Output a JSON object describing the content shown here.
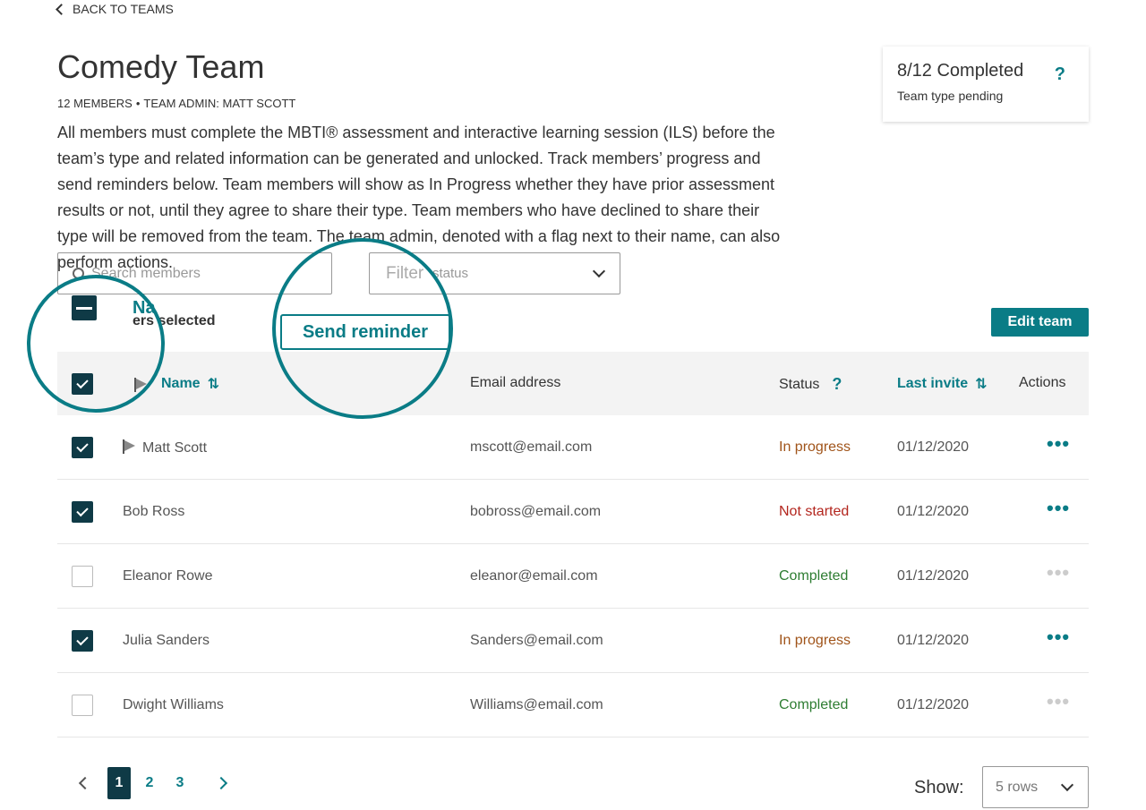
{
  "nav": {
    "back_label": "BACK TO TEAMS"
  },
  "team": {
    "title": "Comedy Team",
    "members_meta": "12 MEMBERS",
    "separator": "•",
    "admin_meta": "TEAM ADMIN: MATT SCOTT",
    "description": "All members must complete the MBTI® assessment and interactive learning session (ILS) before the team’s type and related information can be generated and unlocked. Track members’ progress and send reminders below. Team members will show as In Progress whether they have prior assessment results or not, until they agree to share their type. Team members who have declined to share their type will be removed from the team. The team admin, denoted with a flag next to their name, can also perform actions."
  },
  "status_card": {
    "completed": "8/12 Completed",
    "help_icon": "?",
    "pending": "Team type pending"
  },
  "search": {
    "placeholder": "Search members"
  },
  "filter": {
    "label_big": "Filter",
    "label_small": "status"
  },
  "bulk": {
    "selected_text": "ers selected",
    "send_reminder": "Send reminder",
    "edit_team": "Edit team"
  },
  "table": {
    "headers": {
      "name": "Name",
      "email": "Email address",
      "status": "Status",
      "status_help": "?",
      "last_invite": "Last invite",
      "actions": "Actions"
    },
    "rows": [
      {
        "name": "Matt Scott",
        "email": "mscott@email.com",
        "status": "In progress",
        "date": "01/12/2020",
        "checked": true,
        "admin": true
      },
      {
        "name": "Bob Ross",
        "email": "bobross@email.com",
        "status": "Not started",
        "date": "01/12/2020",
        "checked": true,
        "admin": false
      },
      {
        "name": "Eleanor Rowe",
        "email": "eleanor@email.com",
        "status": "Completed",
        "date": "01/12/2020",
        "checked": false,
        "admin": false
      },
      {
        "name": "Julia Sanders",
        "email": "Sanders@email.com",
        "status": "In progress",
        "date": "01/12/2020",
        "checked": true,
        "admin": false
      },
      {
        "name": "Dwight Williams",
        "email": "Williams@email.com",
        "status": "Completed",
        "date": "01/12/2020",
        "checked": false,
        "admin": false
      }
    ],
    "actions_glyph": "•••"
  },
  "pagination": {
    "pages": [
      "1",
      "2",
      "3"
    ],
    "current": "1"
  },
  "show": {
    "label": "Show:",
    "value": "5 rows"
  },
  "zoom_callouts": {
    "header_fragment": "Na",
    "send_reminder": "Send reminder"
  },
  "colors": {
    "accent": "#0a7c86",
    "dark": "#0f3a46",
    "in_progress": "#a0541a",
    "not_started": "#b3261e",
    "completed": "#2e7d32"
  }
}
